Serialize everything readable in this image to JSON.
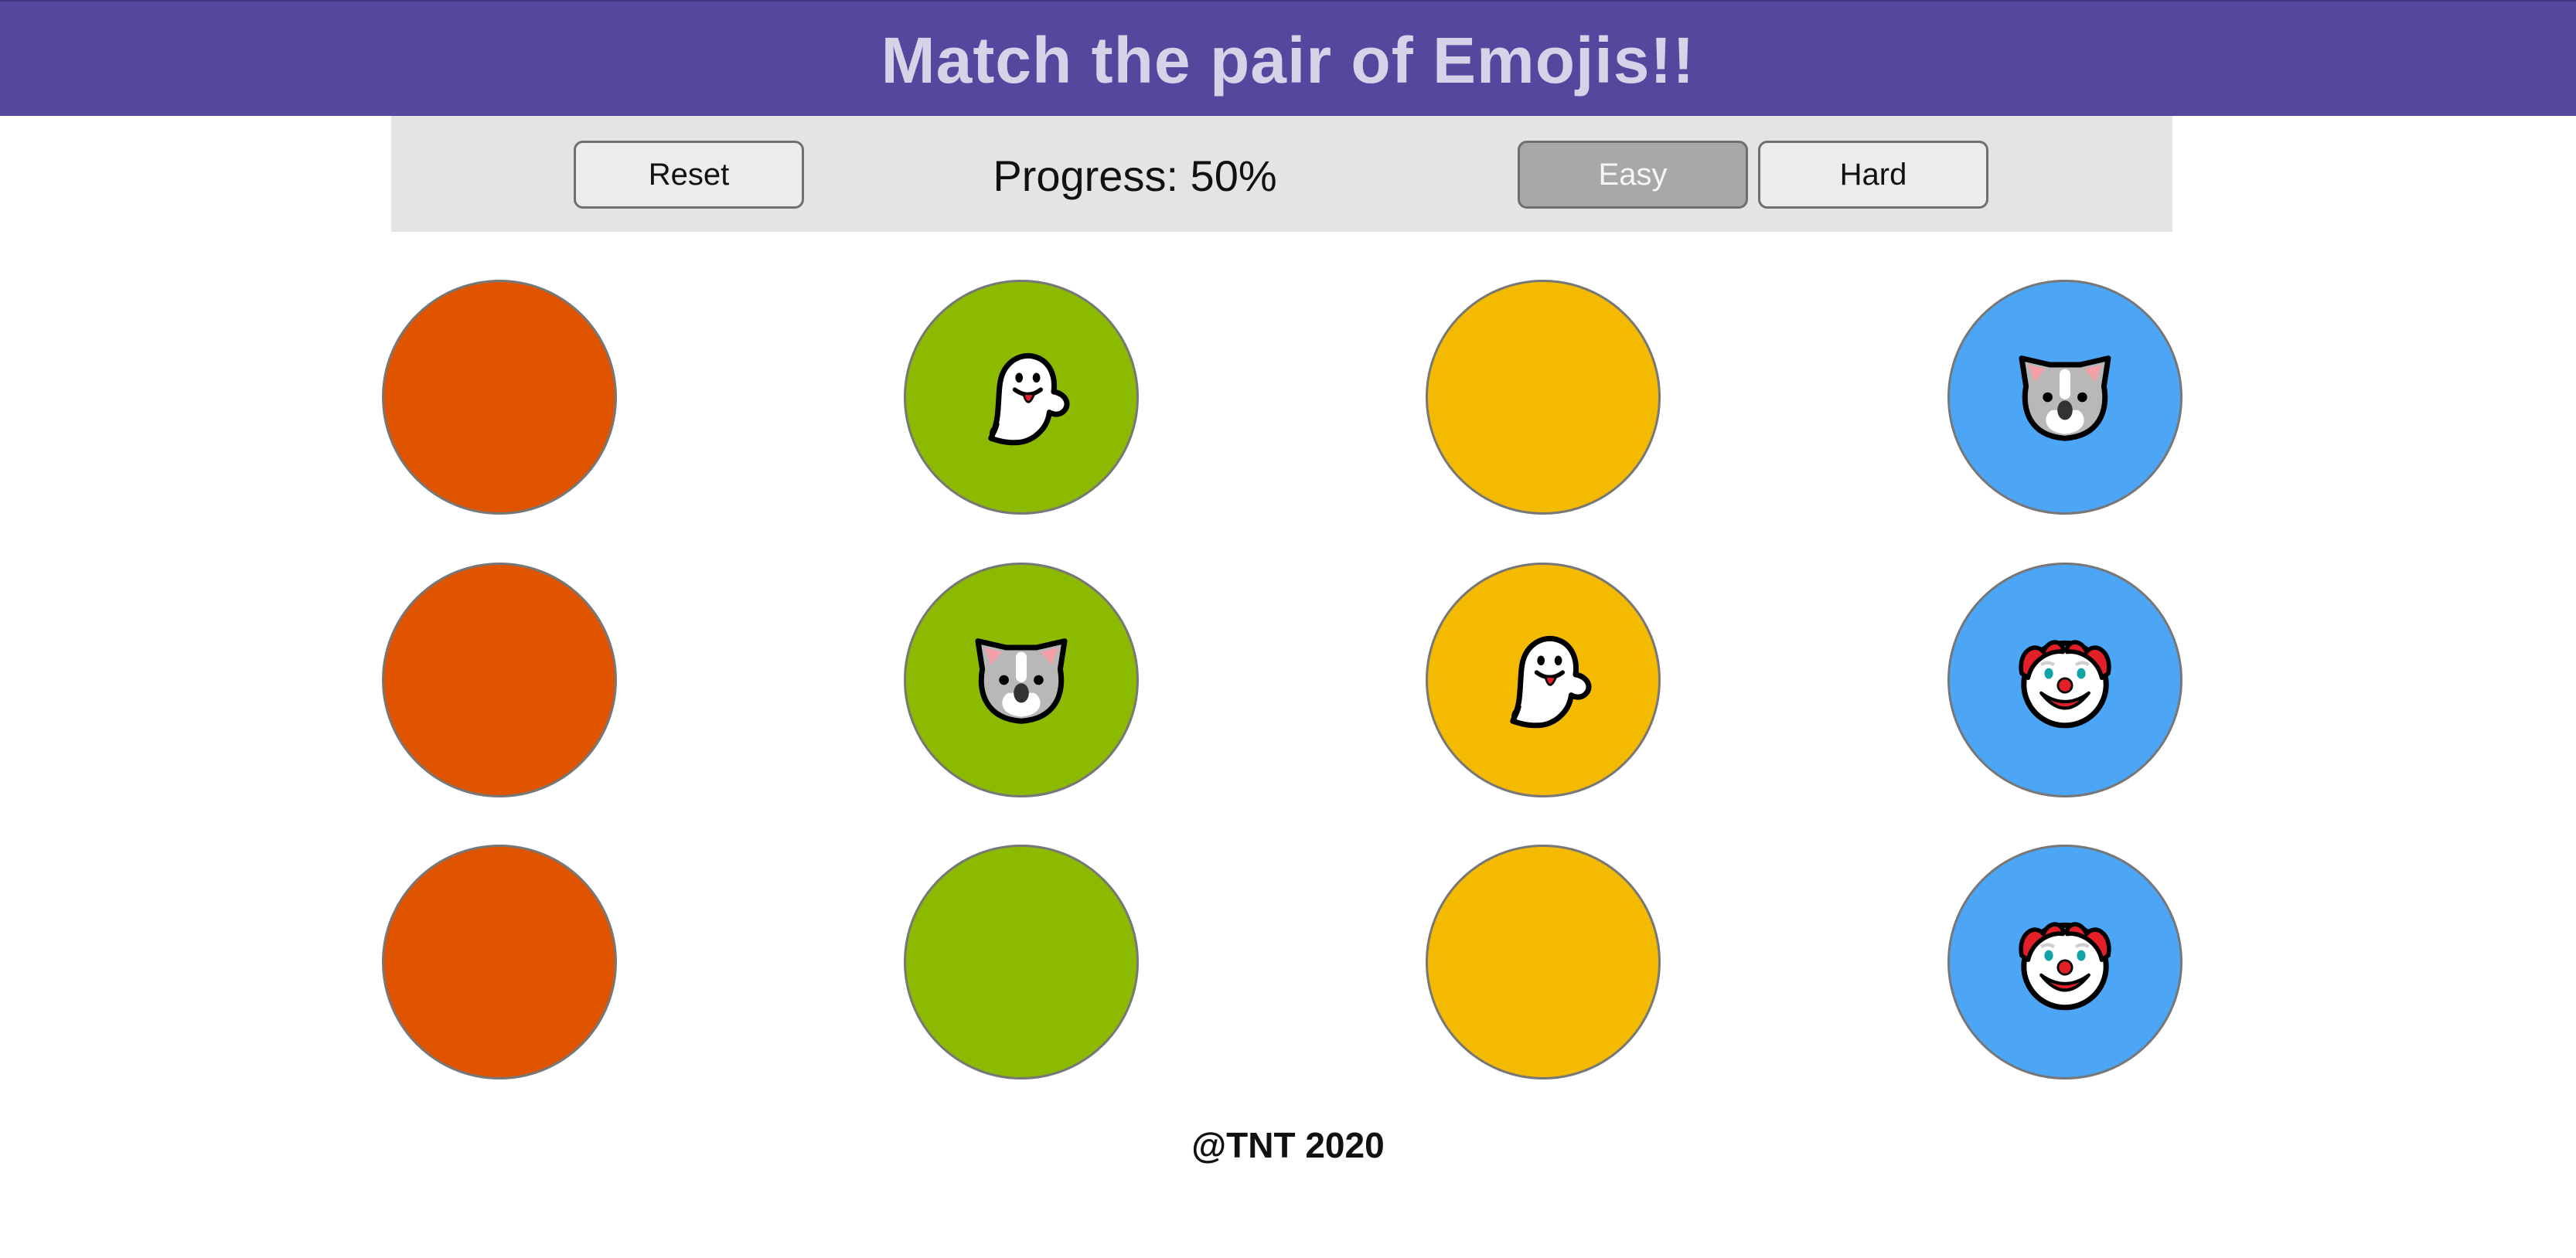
{
  "header": {
    "title": "Match the pair of Emojis!!"
  },
  "controls": {
    "reset_label": "Reset",
    "progress_text": "Progress: 50%",
    "progress_value": 0.5,
    "easy_label": "Easy",
    "hard_label": "Hard",
    "selected_mode": "Easy"
  },
  "colors": {
    "header_bg": "#54479d",
    "orange": "#e05400",
    "green": "#8bba00",
    "yellow": "#f4ba00",
    "blue": "#4ca5f5"
  },
  "board": {
    "cards": [
      {
        "color": "orange",
        "emoji": null
      },
      {
        "color": "green",
        "emoji": "ghost-icon"
      },
      {
        "color": "yellow",
        "emoji": null
      },
      {
        "color": "blue",
        "emoji": "koala-icon"
      },
      {
        "color": "orange",
        "emoji": null
      },
      {
        "color": "green",
        "emoji": "koala-icon"
      },
      {
        "color": "yellow",
        "emoji": "ghost-icon"
      },
      {
        "color": "blue",
        "emoji": "clown-icon"
      },
      {
        "color": "orange",
        "emoji": null
      },
      {
        "color": "green",
        "emoji": null
      },
      {
        "color": "yellow",
        "emoji": null
      },
      {
        "color": "blue",
        "emoji": "clown-icon"
      }
    ]
  },
  "footer": {
    "text": "@TNT 2020"
  }
}
